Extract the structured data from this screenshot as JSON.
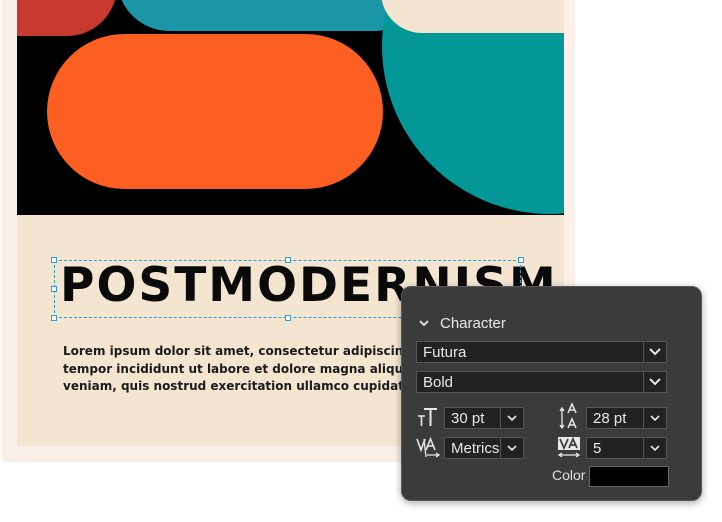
{
  "poster": {
    "headline": "POSTMODERNISM",
    "body_lines": [
      "Lorem ipsum dolor sit amet, consectetur adipiscing eli",
      "tempor incididunt ut labore et dolore magna aliqua. U",
      "veniam, quis nostrud exercitation ullamco cupidatat n"
    ],
    "colors": {
      "background": "#f4e5d1",
      "art_background": "#000000",
      "orange": "#fc5f21",
      "teal": "#049798",
      "light_teal": "#1a96a6",
      "red": "#c8392f",
      "selection": "#2b9fd2"
    }
  },
  "character_panel": {
    "title": "Character",
    "font_family": "Futura",
    "font_style": "Bold",
    "font_size": "30 pt",
    "leading": "28 pt",
    "kerning": "Metrics",
    "tracking": "5",
    "color_label": "Color",
    "color_value": "#000000",
    "icons": {
      "collapse": "chevron-down-icon",
      "font_size": "font-size-icon",
      "leading": "leading-icon",
      "kerning": "kerning-icon",
      "tracking": "tracking-icon"
    }
  }
}
